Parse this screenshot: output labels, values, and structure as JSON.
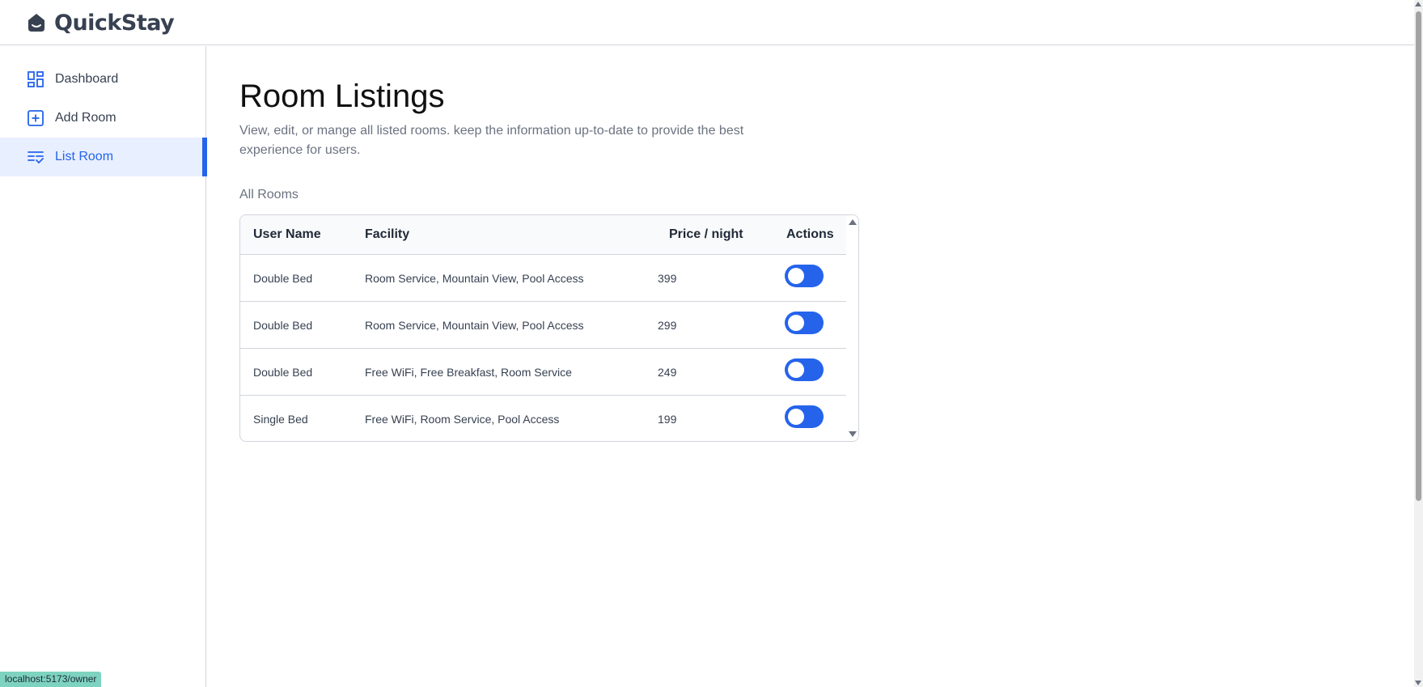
{
  "app": {
    "name": "QuickStay"
  },
  "sidebar": {
    "items": [
      {
        "label": "Dashboard",
        "icon": "dashboard-icon",
        "active": false
      },
      {
        "label": "Add Room",
        "icon": "add-square-icon",
        "active": false
      },
      {
        "label": "List Room",
        "icon": "list-icon",
        "active": true
      }
    ]
  },
  "main": {
    "title": "Room Listings",
    "description": "View, edit, or mange all listed rooms. keep the information up-to-date to provide the best experience for users.",
    "section_label": "All Rooms"
  },
  "table": {
    "headers": {
      "user": "User Name",
      "facility": "Facility",
      "price": "Price / night",
      "actions": "Actions"
    },
    "rows": [
      {
        "name": "Double Bed",
        "facility": "Room Service, Mountain View, Pool Access",
        "price": "399",
        "available": true
      },
      {
        "name": "Double Bed",
        "facility": "Room Service, Mountain View, Pool Access",
        "price": "299",
        "available": true
      },
      {
        "name": "Double Bed",
        "facility": "Free WiFi, Free Breakfast, Room Service",
        "price": "249",
        "available": true
      },
      {
        "name": "Single Bed",
        "facility": "Free WiFi, Room Service, Pool Access",
        "price": "199",
        "available": true
      }
    ]
  },
  "status_bar": {
    "url": "localhost:5173/owner"
  },
  "colors": {
    "accent": "#2563eb",
    "active_bg": "#e8effe",
    "border": "#d1d5db",
    "muted_text": "#6b7280"
  }
}
